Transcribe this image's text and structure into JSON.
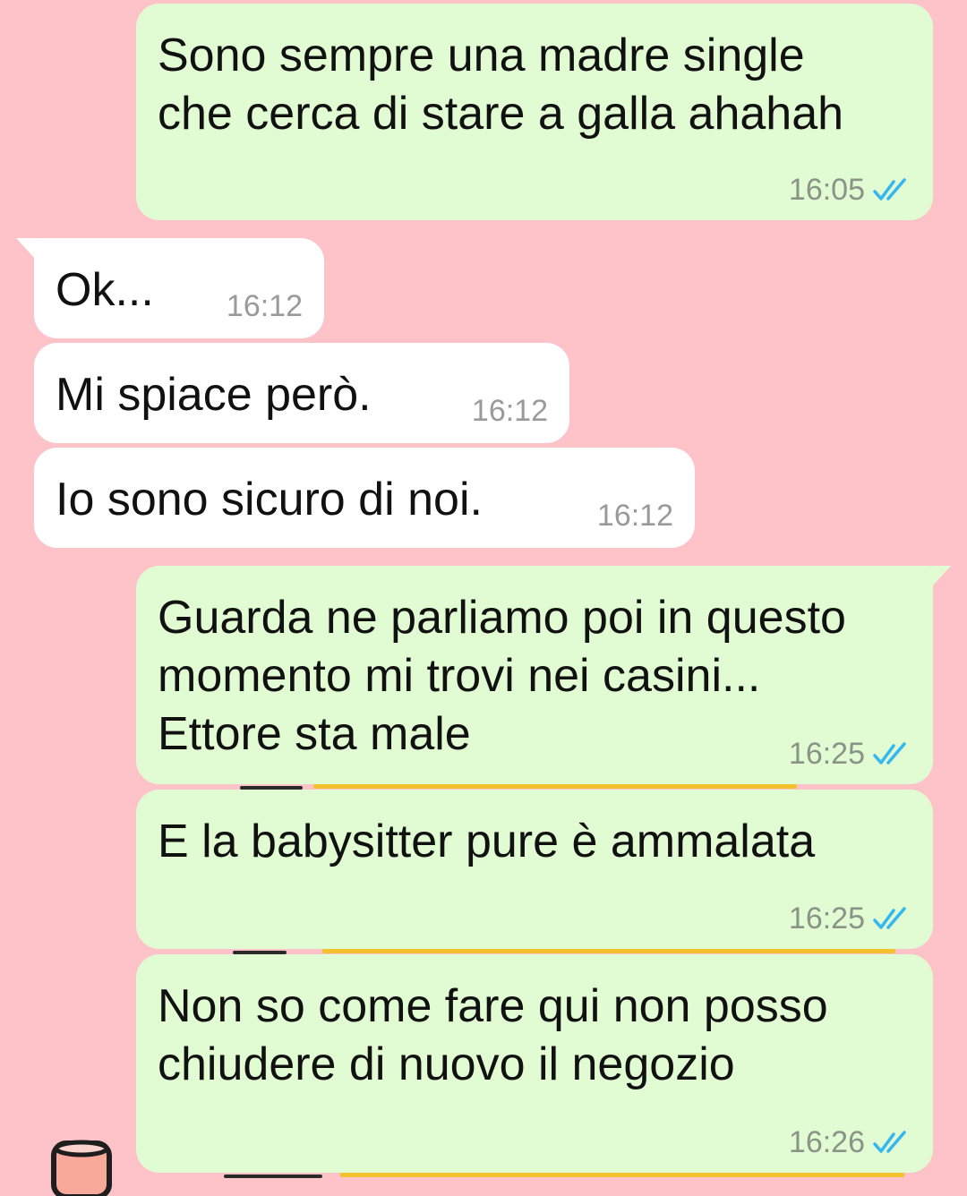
{
  "theme": {
    "wallpaper_color": "#fdc3c8",
    "outgoing_bubble_color": "#e1fbd2",
    "incoming_bubble_color": "#ffffff",
    "read_ticks_color": "#34b7f1"
  },
  "messages": [
    {
      "direction": "outgoing",
      "text": "Sono sempre una madre single\nche cerca di stare a galla ahahah",
      "time": "16:05",
      "status": "read"
    },
    {
      "direction": "incoming",
      "text": "Ok...",
      "time": "16:12"
    },
    {
      "direction": "incoming",
      "text": "Mi spiace però.",
      "time": "16:12"
    },
    {
      "direction": "incoming",
      "text": "Io sono sicuro di noi.",
      "time": "16:12"
    },
    {
      "direction": "outgoing",
      "text": "Guarda ne parliamo poi in questo\nmomento mi trovi nei casini...\nEttore sta male",
      "time": "16:25",
      "status": "read"
    },
    {
      "direction": "outgoing",
      "text": "E la babysitter pure è ammalata",
      "time": "16:25",
      "status": "read"
    },
    {
      "direction": "outgoing",
      "text": "Non so come fare qui non posso\nchiudere di nuovo il negozio",
      "time": "16:26",
      "status": "read"
    }
  ]
}
